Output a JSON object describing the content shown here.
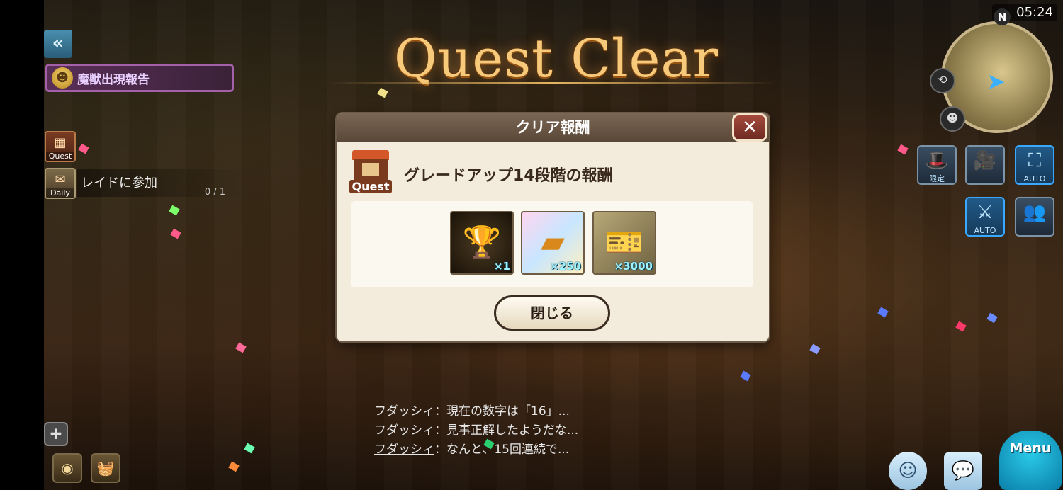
{
  "hud": {
    "clock": "05:24",
    "compass_label": "N",
    "event_banner": "魔獣出現報告",
    "quest_tracker_label": "Quest",
    "daily_label": "Daily",
    "daily_task": "レイドに参加",
    "daily_progress": "0 / 1",
    "limited_label": "限定",
    "auto_label_1": "AUTO",
    "auto_label_2": "AUTO",
    "menu_label": "Menu"
  },
  "banner": {
    "title": "Quest Clear"
  },
  "dialog": {
    "header": "クリア報酬",
    "quest_icon_caption": "Quest",
    "reward_title": "グレードアップ14段階の報酬",
    "items": [
      {
        "icon": "trophy-emblem-icon",
        "qty": "×1"
      },
      {
        "icon": "gold-bar-icon",
        "qty": "×250"
      },
      {
        "icon": "ticket-icon",
        "qty": "×3000"
      }
    ],
    "close_button": "閉じる"
  },
  "chat": [
    {
      "name": "フダッシィ",
      "text": "：現在の数字は「16」..."
    },
    {
      "name": "フダッシィ",
      "text": "：見事正解したようだな..."
    },
    {
      "name": "フダッシィ",
      "text": "：なんと、15回連続で..."
    }
  ],
  "colors": {
    "accent_gold": "#f7c97a",
    "dialog_bg": "#f3ecdc",
    "header_bg": "#6b5846",
    "auto_blue": "#3aa8ff"
  }
}
